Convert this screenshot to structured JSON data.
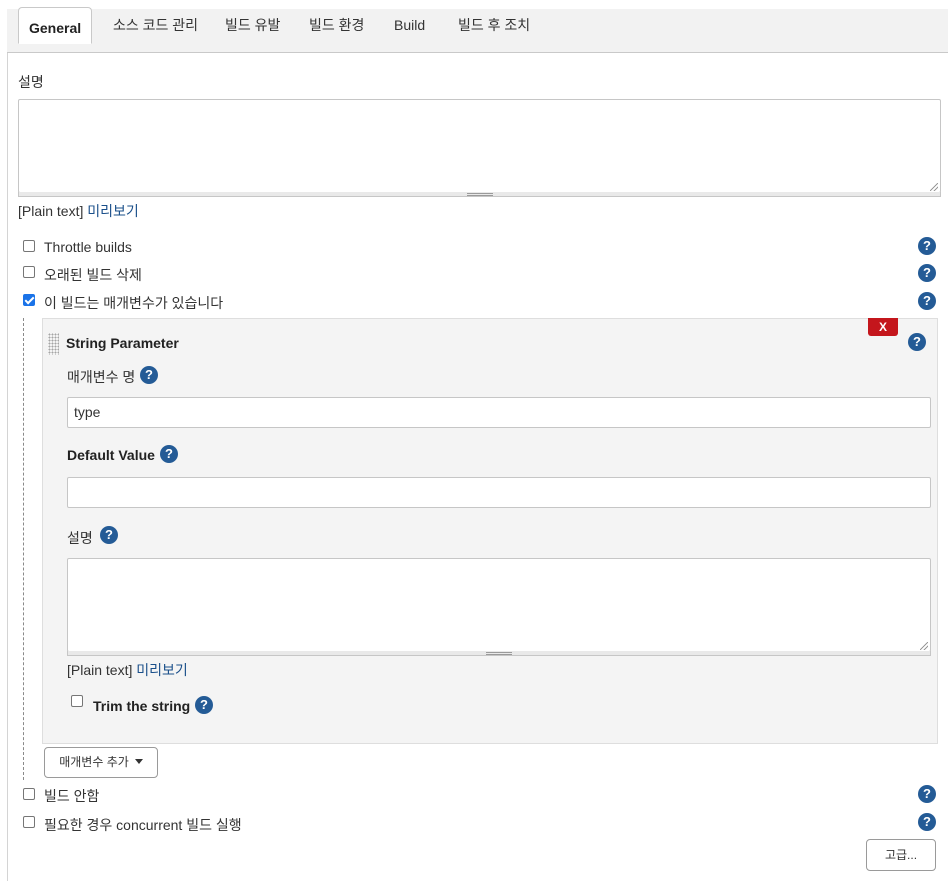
{
  "tabs": {
    "general": "General",
    "scm": "소스 코드 관리",
    "triggers": "빌드 유발",
    "env": "빌드 환경",
    "build": "Build",
    "post": "빌드 후 조치"
  },
  "description": {
    "label": "설명",
    "value": "",
    "plain_text": "[Plain text]",
    "preview": "미리보기"
  },
  "options": {
    "throttle": {
      "label": "Throttle builds",
      "checked": false
    },
    "discard_old": {
      "label": "오래된 빌드 삭제",
      "checked": false
    },
    "parameterized": {
      "label": "이 빌드는 매개변수가 있습니다",
      "checked": true
    },
    "disable": {
      "label": "빌드 안함",
      "checked": false
    },
    "concurrent": {
      "label": "필요한 경우 concurrent 빌드 실행",
      "checked": false
    }
  },
  "parameter": {
    "title": "String Parameter",
    "delete_label": "X",
    "name_label": "매개변수 명",
    "name_value": "type",
    "default_label": "Default Value",
    "default_value": "",
    "desc_label": "설명",
    "desc_value": "",
    "plain_text": "[Plain text]",
    "preview": "미리보기",
    "trim_label": "Trim the string",
    "trim_checked": false
  },
  "add_param_button": "매개변수 추가",
  "advanced_button": "고급...",
  "help_glyph": "?",
  "colors": {
    "help": "#245b96",
    "link": "#1a4f8a",
    "delete": "#c4161c",
    "checkbox_checked": "#1a73e8"
  },
  "icons": {
    "help": "question-circle-icon",
    "add_dropdown": "caret-down-icon",
    "drag": "drag-handle-icon",
    "checked": "checkmark-icon"
  }
}
